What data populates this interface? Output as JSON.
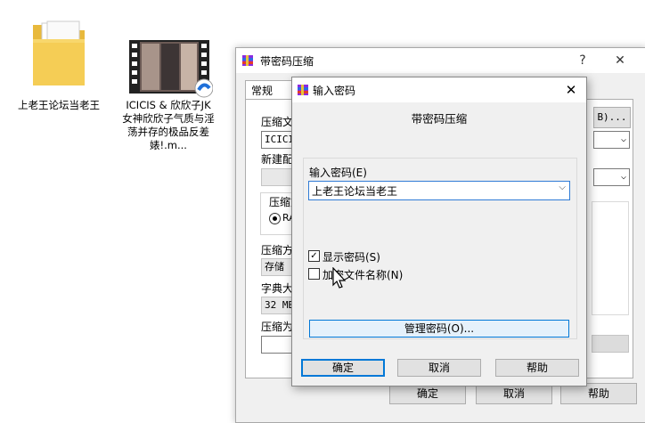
{
  "desktop": {
    "icons": [
      {
        "label": "上老王论坛当老王",
        "icon": "folder-icon"
      },
      {
        "label": "ICICIS & 欣欣子JK女神欣欣子气质与淫荡并存的极品反差婊!.m...",
        "icon": "video-file-icon"
      }
    ]
  },
  "back_dialog": {
    "title": "带密码压缩",
    "help_glyph": "?",
    "close_glyph": "✕",
    "tab_general": "常规",
    "archive_name_label": "压缩文",
    "archive_name_value": "ICICIS",
    "profile_label": "新建配",
    "format_group_label": "压缩文",
    "format_option": "RA",
    "method_label": "压缩方",
    "method_value": "存储",
    "dict_label": "字典大",
    "dict_value": "32 MB",
    "split_label": "压缩为",
    "browse_label": "B)...",
    "ok_label": "确定",
    "cancel_label": "取消",
    "help_label": "帮助"
  },
  "front_dialog": {
    "title": "输入密码",
    "close_glyph": "✕",
    "heading": "带密码压缩",
    "password_label": "输入密码(E)",
    "password_value": "上老王论坛当老王",
    "show_password_label": "显示密码(S)",
    "show_password_checked": true,
    "encrypt_names_label": "加密文件名称(N)",
    "encrypt_names_checked": false,
    "manage_label": "管理密码(O)...",
    "ok_label": "确定",
    "cancel_label": "取消",
    "help_label": "帮助"
  },
  "colors": {
    "accent": "#0078d7",
    "dialog_bg": "#f0f0f0"
  }
}
